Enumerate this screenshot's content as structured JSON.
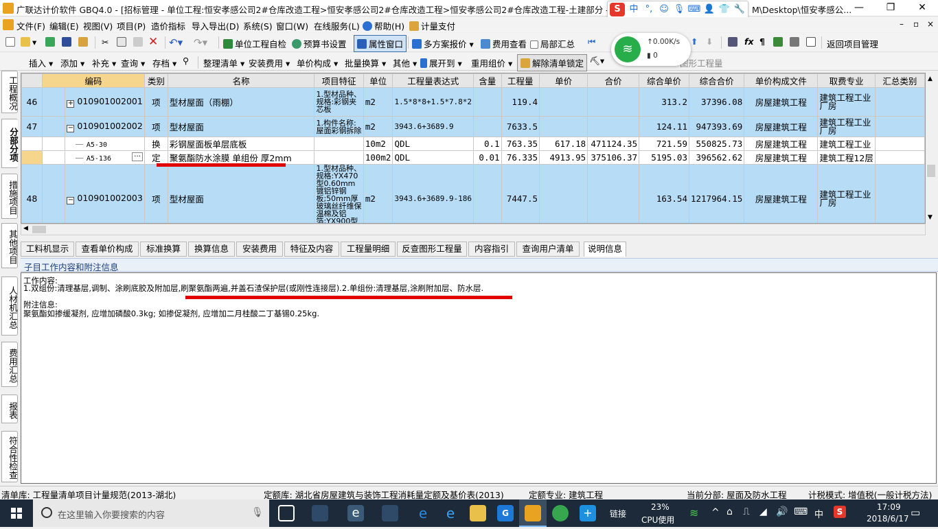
{
  "window": {
    "title": "广联达计价软件 GBQ4.0 - [招标管理 - 单位工程:恒安孝感公司2#仓库改造工程>恒安孝感公司2#仓库改造工程>恒安孝感公司2#仓库改造工程-土建部分 - C:\\Use",
    "title_tail": "M\\Desktop\\恒安孝感公..."
  },
  "ime": {
    "logo": "S",
    "lang": "中",
    "punct": "°,"
  },
  "menu": [
    "文件(F)",
    "编辑(E)",
    "视图(V)",
    "项目(P)",
    "造价指标",
    "导入导出(D)",
    "系统(S)",
    "窗口(W)",
    "在线服务(L)",
    "帮助(H)",
    "计量支付"
  ],
  "toolbar1": {
    "self_check": "单位工程自检",
    "budget_settings": "预算书设置",
    "property_window": "属性窗口",
    "multi_quote": "多方案报价",
    "fee_view": "费用查看",
    "partial_total": "局部汇总",
    "back_to_project": "返回项目管理"
  },
  "netspeed": {
    "up": "0.00K/s",
    "down": "0"
  },
  "toolbar2": {
    "insert": "插入",
    "add": "添加",
    "supplement": "补充",
    "query": "查询",
    "archive": "存档",
    "organize": "整理清单",
    "install_fee": "安装费用",
    "unit_price_comp": "单价构成",
    "batch_convert": "批量换算",
    "other": "其他",
    "expand_to": "展开到",
    "regroup": "重用组价",
    "unlock": "解除清单锁定",
    "graphic_qty": "图形工程量"
  },
  "side_tabs": [
    "工程概况",
    "分部分项",
    "措施项目",
    "其他项目",
    "人材机汇总",
    "费用汇总",
    "报表",
    "符合性检查"
  ],
  "grid": {
    "columns": [
      "编码",
      "类别",
      "名称",
      "项目特征",
      "单位",
      "工程量表达式",
      "含量",
      "工程量",
      "单价",
      "合价",
      "综合单价",
      "综合合价",
      "单价构成文件",
      "取费专业",
      "汇总类别"
    ],
    "rows": [
      {
        "no": "46",
        "toggle": "+",
        "code": "010901002001",
        "type": "项",
        "name": "型材屋面（雨棚）",
        "feature": "1.型材品种、规格:彩钢夹芯板",
        "unit": "m2",
        "expr": "1.5*8*8+1.5*7.8*2",
        "content": "",
        "qty": "119.4",
        "price": "",
        "total": "",
        "cprice": "313.2",
        "ctotal": "37396.08",
        "file": "房屋建筑工程",
        "fee": "建筑工程工业厂房",
        "sum": ""
      },
      {
        "no": "47",
        "toggle": "−",
        "code": "010901002002",
        "type": "项",
        "name": "型材屋面",
        "feature": "1.构件名称:屋面彩钢拆除",
        "unit": "m2",
        "expr": "3943.6+3689.9",
        "content": "",
        "qty": "7633.5",
        "price": "",
        "total": "",
        "cprice": "124.11",
        "ctotal": "947393.69",
        "file": "房屋建筑工程",
        "fee": "建筑工程工业厂房",
        "sum": ""
      },
      {
        "no": "",
        "toggle": "",
        "code": "A5-30",
        "type": "换",
        "name": "彩钢屋面板单层底板",
        "feature": "",
        "unit": "10m2",
        "expr": "QDL",
        "content": "0.1",
        "qty": "763.35",
        "price": "617.18",
        "total": "471124.35",
        "cprice": "721.59",
        "ctotal": "550825.73",
        "file": "房屋建筑工程",
        "fee": "建筑工程工业",
        "sum": ""
      },
      {
        "no": "",
        "toggle": "",
        "code": "A5-136",
        "type": "定",
        "name": "聚氨酯防水涂膜 单组份 厚2mm",
        "feature": "",
        "unit": "100m2",
        "expr": "QDL",
        "content": "0.01",
        "qty": "76.335",
        "price": "4913.95",
        "total": "375106.37",
        "cprice": "5195.03",
        "ctotal": "396562.62",
        "file": "房屋建筑工程",
        "fee": "建筑工程12层",
        "sum": ""
      },
      {
        "no": "48",
        "toggle": "−",
        "code": "010901002003",
        "type": "项",
        "name": "型材屋面",
        "feature": "1.型材品种、规格:YX470型0.60mm镀铝锌钢板;50mm厚玻璃丝纤维保温棉及铝箔;YX900型0.426",
        "unit": "m2",
        "expr": "3943.6+3689.9-186",
        "content": "",
        "qty": "7447.5",
        "price": "",
        "total": "",
        "cprice": "163.54",
        "ctotal": "1217964.15",
        "file": "房屋建筑工程",
        "fee": "建筑工程工业厂房",
        "sum": ""
      }
    ]
  },
  "bottom_tabs": [
    "工料机显示",
    "查看单价构成",
    "标准换算",
    "换算信息",
    "安装费用",
    "特征及内容",
    "工程量明细",
    "反查图形工程量",
    "内容指引",
    "查询用户清单",
    "说明信息"
  ],
  "desc": {
    "header": "子目工作内容和附注信息",
    "work_title": "工作内容:",
    "work_text": "1.双组份:清理基层,调制、涂刷底胶及附加层,刷聚氨酯两遍,并盖石渣保护层(或刚性连接层).2.单组份:清理基层,涂刷附加层、防水层.",
    "note_title": "附注信息:",
    "note_text": "聚氨酯如掺缓凝剂, 应增加磷酸0.3kg; 如掺促凝剂, 应增加二月桂酸二丁基锡0.25kg."
  },
  "status": {
    "list_lib": "清单库:  工程量清单项目计量规范(2013-湖北)",
    "quota_lib": "定额库:  湖北省房屋建筑与装饰工程消耗量定额及基价表(2013)",
    "quota_major": "定额专业:  建筑工程",
    "current_part": "当前分部:  屋面及防水工程",
    "tax_mode": "计税模式:  增值税(一般计税方法)"
  },
  "taskbar": {
    "search_placeholder": "在这里输入你要搜索的内容",
    "link": "链接",
    "cpu_pct": "23%",
    "cpu_label": "CPU使用",
    "ime": "中",
    "time": "17:09",
    "date": "2018/6/17"
  }
}
